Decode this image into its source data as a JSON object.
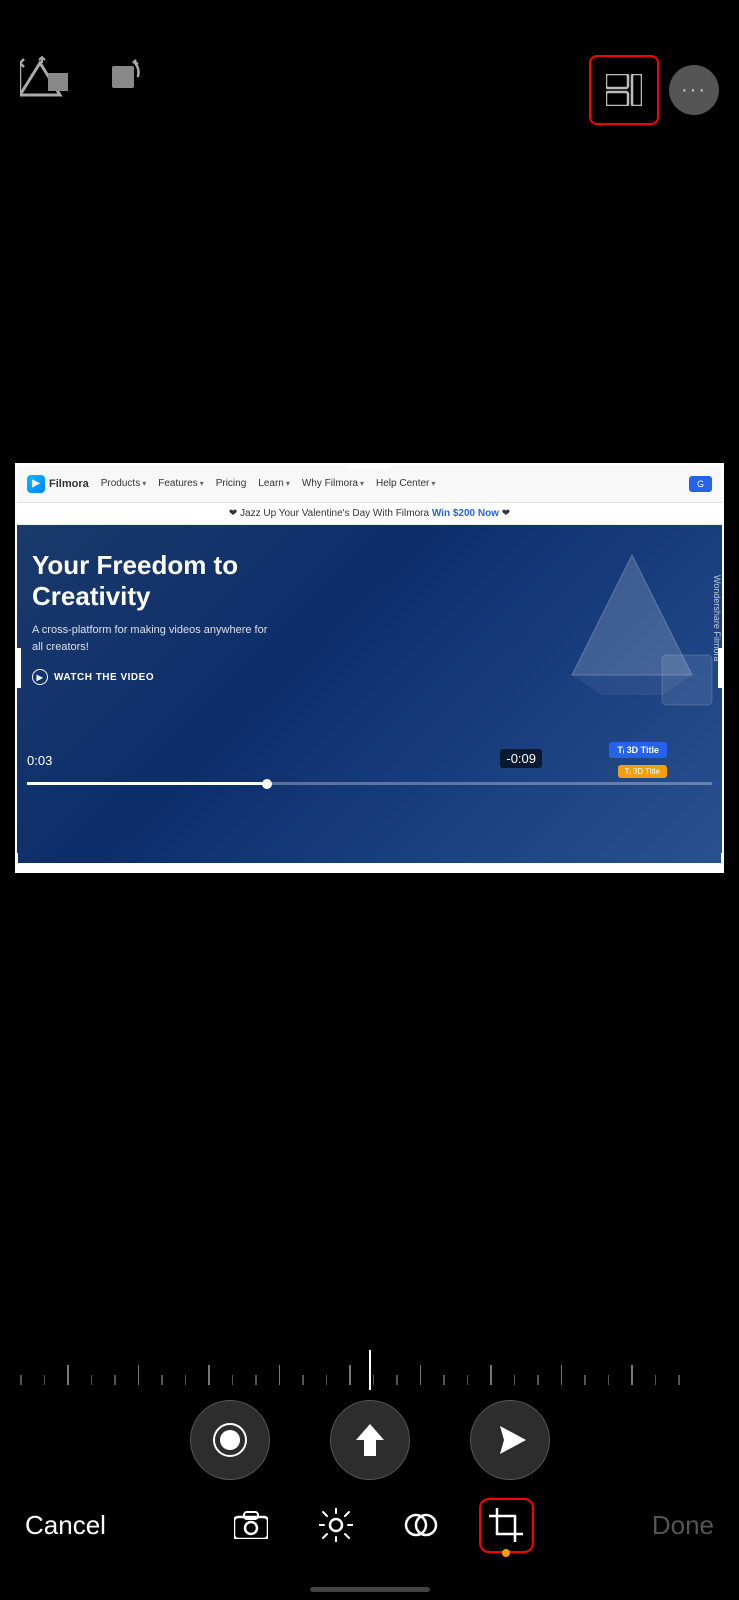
{
  "topBar": {
    "leftIcons": [
      {
        "name": "mountain-icon",
        "symbol": "⛰"
      },
      {
        "name": "rotate-icon",
        "symbol": "↺"
      }
    ],
    "rightIcons": {
      "layout-icon": {
        "label": "⊞",
        "highlighted": true
      },
      "more-icon": {
        "label": "•••"
      }
    }
  },
  "videoFrame": {
    "nav": {
      "logo": "Filmora",
      "items": [
        "Products",
        "Features",
        "Pricing",
        "Learn",
        "Why Filmora",
        "Help Center"
      ],
      "cta": "G"
    },
    "promo": {
      "text": "❤ Jazz Up Your Valentine's Day With Filmora Win $200 Now ❤"
    },
    "hero": {
      "title": "Your Freedom to Creativity",
      "subtitle": "A cross-platform for making videos anywhere for all creators!",
      "watchLabel": "WATCH THE VIDEO",
      "timeCurrent": "0:03",
      "timeRemaining": "-0:09",
      "badge3D": "🅃ᵢ 3D Title",
      "badgeYellow": "🅃ᵢ 3D Title"
    }
  },
  "controls": {
    "buttons": [
      {
        "name": "record-button",
        "symbol": "⏺"
      },
      {
        "name": "upload-button",
        "symbol": "▲"
      },
      {
        "name": "send-button",
        "symbol": "◄"
      }
    ]
  },
  "toolbar": {
    "cancel": "Cancel",
    "done": "Done",
    "icons": [
      {
        "name": "camera-icon",
        "symbol": "📷",
        "active": false
      },
      {
        "name": "brightness-icon",
        "symbol": "✳",
        "active": false
      },
      {
        "name": "blend-icon",
        "symbol": "◎",
        "active": false
      },
      {
        "name": "crop-icon",
        "symbol": "⧉",
        "active": true,
        "dot": true
      }
    ]
  }
}
